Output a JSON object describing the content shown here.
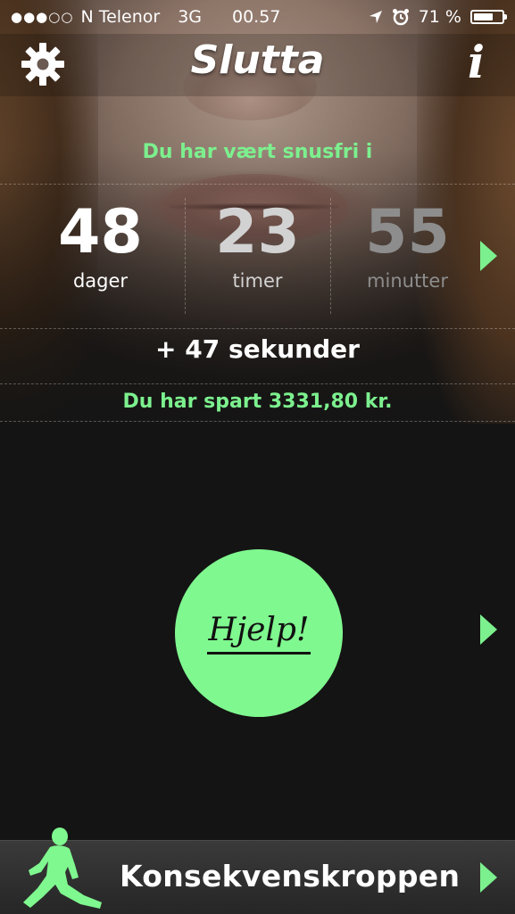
{
  "status_bar": {
    "signal": "●●●○○",
    "carrier": "N Telenor",
    "network": "3G",
    "time": "00.57",
    "location_icon": "location-arrow-icon",
    "alarm_icon": "alarm-clock-icon",
    "battery_percent": "71 %",
    "battery_level": 0.71
  },
  "nav": {
    "title": "Slutta",
    "settings_icon": "gear-icon",
    "info_label": "i"
  },
  "counter": {
    "headline": "Du har vært snusfri i",
    "days": "48",
    "days_label": "dager",
    "hours": "23",
    "hours_label": "timer",
    "minutes": "55",
    "minutes_label": "minutter",
    "seconds_text": "+ 47 sekunder",
    "saved_text": "Du har spart 3331,80 kr."
  },
  "help": {
    "label": "Hjelp!"
  },
  "bottom": {
    "label": "Konsekvenskroppen",
    "icon": "running-man-icon"
  },
  "colors": {
    "accent": "#7cf08e",
    "background": "#141414"
  }
}
